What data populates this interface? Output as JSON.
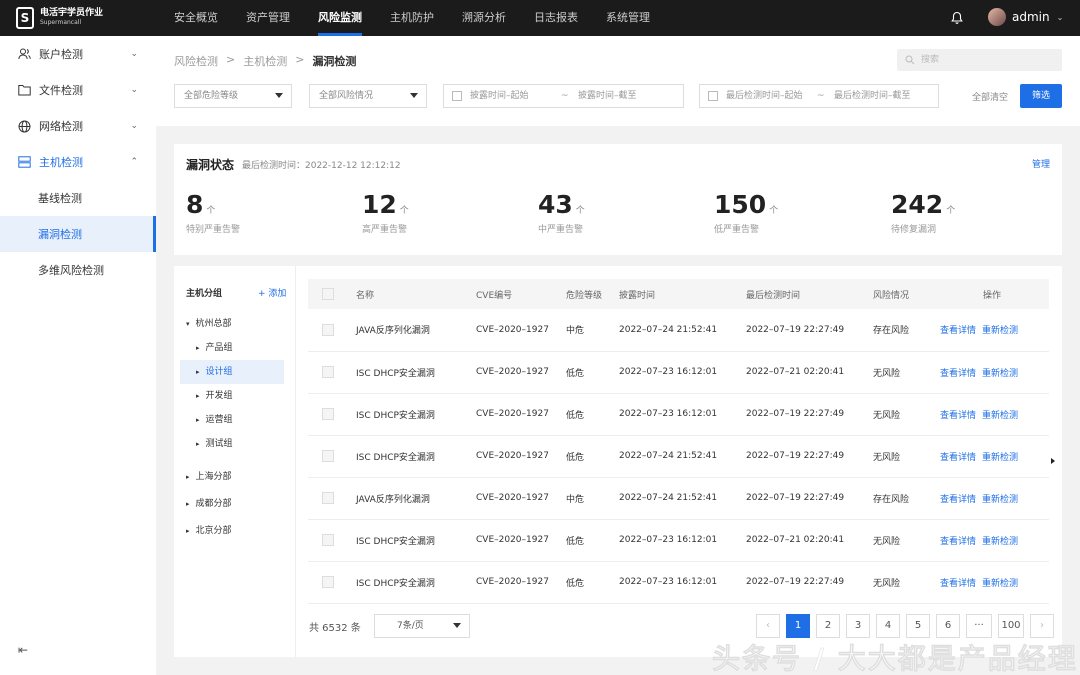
{
  "brand": {
    "mark": "S",
    "title": "电活宇学员作业",
    "subtitle": "Supermancall"
  },
  "nav": [
    "安全概览",
    "资产管理",
    "风险监测",
    "主机防护",
    "溯源分析",
    "日志报表",
    "系统管理"
  ],
  "nav_active": 2,
  "user": {
    "name": "admin",
    "chevron": "⌄"
  },
  "sidebar": {
    "items": [
      {
        "label": "账户检测",
        "icon": "users-icon",
        "arrow": "⌄"
      },
      {
        "label": "文件检测",
        "icon": "folder-icon",
        "arrow": "⌄"
      },
      {
        "label": "网络检测",
        "icon": "globe-icon",
        "arrow": "⌄"
      },
      {
        "label": "主机检测",
        "icon": "server-icon",
        "arrow": "⌃"
      }
    ],
    "subitems": [
      "基线检测",
      "漏洞检测",
      "多维风险检测"
    ],
    "active_sub": 1,
    "collapse_icon": "⇤"
  },
  "breadcrumb": {
    "items": [
      "风险检测",
      "主机检测",
      "漏洞检测"
    ],
    "sep": ">"
  },
  "search": {
    "placeholder": "搜索"
  },
  "filters": {
    "risk_level": "全部危险等级",
    "risk_status": "全部风险情况",
    "exposure_start": "披露时间–起始",
    "exposure_end": "披露时间–截至",
    "detect_start": "最后检测时间–起始",
    "detect_end": "最后检测时间–截至",
    "range_sep": "~",
    "clear": "全部清空",
    "submit": "筛选"
  },
  "status": {
    "title": "漏洞状态",
    "last_check": "最后检测时间：2022-12-12 12:12:12",
    "manage": "管理",
    "unit": "个",
    "stats": [
      {
        "value": "8",
        "label": "特别严重告警"
      },
      {
        "value": "12",
        "label": "高严重告警"
      },
      {
        "value": "43",
        "label": "中严重告警"
      },
      {
        "value": "150",
        "label": "低严重告警"
      },
      {
        "value": "242",
        "label": "待修复漏洞"
      }
    ]
  },
  "groups": {
    "title": "主机分组",
    "add": "+ 添加",
    "root": "杭州总部",
    "children": [
      "产品组",
      "设计组",
      "开发组",
      "运营组",
      "测试组"
    ],
    "active_child": 1,
    "others": [
      "上海分部",
      "成都分部",
      "北京分部"
    ]
  },
  "table": {
    "headers": [
      "名称",
      "CVE编号",
      "危险等级",
      "披露时间",
      "最后检测时间",
      "风险情况",
      "操作"
    ],
    "actions": [
      "查看详情",
      "重新检测"
    ],
    "rows": [
      [
        "JAVA反序列化漏洞",
        "CVE–2020–1927",
        "中危",
        "2022–07–24 21:52:41",
        "2022–07–19 22:27:49",
        "存在风险"
      ],
      [
        "ISC DHCP安全漏洞",
        "CVE–2020–1927",
        "低危",
        "2022–07–23 16:12:01",
        "2022–07–21 02:20:41",
        "无风险"
      ],
      [
        "ISC DHCP安全漏洞",
        "CVE–2020–1927",
        "低危",
        "2022–07–23 16:12:01",
        "2022–07–19 22:27:49",
        "无风险"
      ],
      [
        "ISC DHCP安全漏洞",
        "CVE–2020–1927",
        "低危",
        "2022–07–24 21:52:41",
        "2022–07–19 22:27:49",
        "无风险"
      ],
      [
        "JAVA反序列化漏洞",
        "CVE–2020–1927",
        "中危",
        "2022–07–24 21:52:41",
        "2022–07–19 22:27:49",
        "存在风险"
      ],
      [
        "ISC DHCP安全漏洞",
        "CVE–2020–1927",
        "低危",
        "2022–07–23 16:12:01",
        "2022–07–21 02:20:41",
        "无风险"
      ],
      [
        "ISC DHCP安全漏洞",
        "CVE–2020–1927",
        "低危",
        "2022–07–23 16:12:01",
        "2022–07–19 22:27:49",
        "无风险"
      ]
    ]
  },
  "pagination": {
    "total": "共 6532 条",
    "page_size": "7条/页",
    "pages": [
      "1",
      "2",
      "3",
      "4",
      "5",
      "6",
      "···",
      "100"
    ],
    "active": "1",
    "prev": "‹",
    "next": "›"
  },
  "watermark": "头条号 / 大大都是产品经理"
}
